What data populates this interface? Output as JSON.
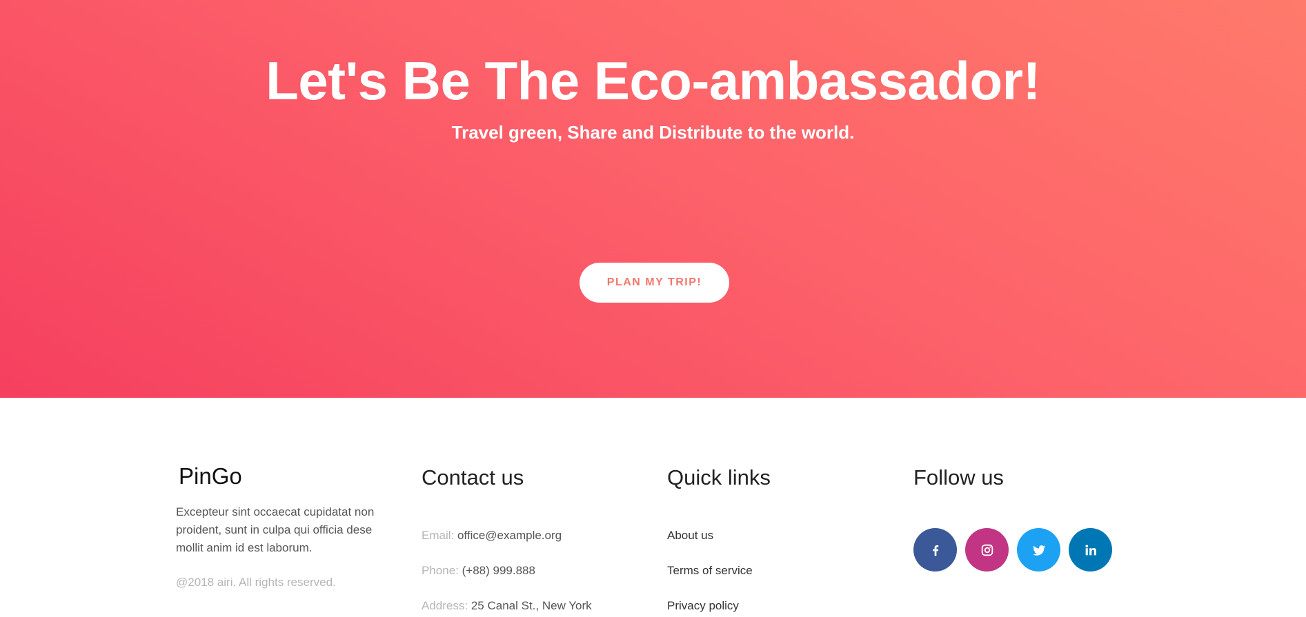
{
  "hero": {
    "title": "Let's Be The Eco-ambassador!",
    "subtitle": "Travel green, Share and Distribute to the world.",
    "cta_label": "PLAN MY TRIP!",
    "gradient_colors": [
      "#f5405f",
      "#fd626a",
      "#ff7a6b"
    ]
  },
  "footer": {
    "brand": {
      "name": "PinGo",
      "description": "Excepteur sint occaecat cupidatat non proident, sunt in culpa qui officia dese mollit anim id est laborum.",
      "copyright": "@2018 airi. All rights reserved."
    },
    "contact": {
      "heading": "Contact us",
      "email_label": "Email:",
      "email_value": "office@example.org",
      "phone_label": "Phone:",
      "phone_value": "(+88) 999.888",
      "address_label": "Address:",
      "address_value": "25 Canal St., New York"
    },
    "quick_links": {
      "heading": "Quick links",
      "items": [
        "About us",
        "Terms of service",
        "Privacy policy"
      ]
    },
    "follow": {
      "heading": "Follow us",
      "networks": [
        {
          "icon": "facebook-icon",
          "color": "#3b5998"
        },
        {
          "icon": "instagram-icon",
          "color": "#c13584"
        },
        {
          "icon": "twitter-icon",
          "color": "#1da1f2"
        },
        {
          "icon": "linkedin-icon",
          "color": "#0077b5"
        }
      ]
    }
  }
}
